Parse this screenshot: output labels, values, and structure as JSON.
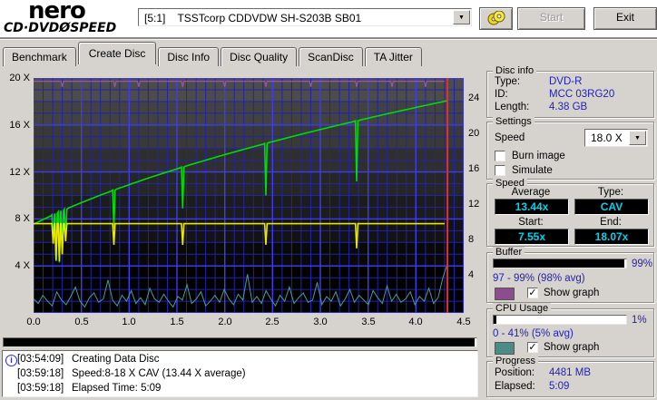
{
  "window": {
    "logo_line1": "nero",
    "logo_line2": "CD·DVDØSPEED",
    "drive_selector": "[5:1]    TSSTcorp CDDVDW SH-S203B SB01",
    "start_label": "Start",
    "exit_label": "Exit"
  },
  "tabs": {
    "items": [
      "Benchmark",
      "Create Disc",
      "Disc Info",
      "Disc Quality",
      "ScanDisc",
      "TA Jitter"
    ],
    "active": "Create Disc"
  },
  "chart_data": {
    "type": "line",
    "title": "Create Disc write test",
    "x_unit": "GB",
    "x_ticks": [
      "0.0",
      "0.5",
      "1.0",
      "1.5",
      "2.0",
      "2.5",
      "3.0",
      "3.5",
      "4.0",
      "4.5"
    ],
    "xlim": [
      0,
      4.5
    ],
    "left_axis": {
      "ticks": [
        "20 X",
        "16 X",
        "12 X",
        "8 X",
        "4 X"
      ],
      "max": 20
    },
    "right_axis": {
      "ticks": [
        "24",
        "20",
        "16",
        "12",
        "8",
        "4"
      ]
    },
    "grid": {
      "minor_color": "#2323a6",
      "major_color": "#3d3dee",
      "band_top": "#4c4c4c",
      "band_bottom": "#000000"
    },
    "series": [
      {
        "name": "write-speed",
        "color": "#00dd00",
        "kind": "ramp",
        "start": 7.55,
        "end": 18.07,
        "x_end": 4.33,
        "dips": [
          {
            "x": 0.205,
            "v": 6.0
          },
          {
            "x": 0.235,
            "v": 4.4
          },
          {
            "x": 0.27,
            "v": 4.3
          },
          {
            "x": 0.3,
            "v": 5.2
          },
          {
            "x": 0.335,
            "v": 6.3
          },
          {
            "x": 0.84,
            "v": 7.2
          },
          {
            "x": 1.56,
            "v": 8.9
          },
          {
            "x": 2.43,
            "v": 10.0
          },
          {
            "x": 3.38,
            "v": 11.2
          }
        ]
      },
      {
        "name": "rotation-speed",
        "color": "#e8e800",
        "kind": "flat",
        "baseline": 7.6,
        "x_end": 4.33,
        "dips": [
          {
            "x": 0.205,
            "v": 5.9
          },
          {
            "x": 0.235,
            "v": 4.5
          },
          {
            "x": 0.27,
            "v": 4.4
          },
          {
            "x": 0.3,
            "v": 5.0
          },
          {
            "x": 0.335,
            "v": 6.1
          },
          {
            "x": 0.84,
            "v": 5.8
          },
          {
            "x": 1.56,
            "v": 5.8
          },
          {
            "x": 2.43,
            "v": 5.8
          },
          {
            "x": 3.38,
            "v": 5.5
          }
        ]
      },
      {
        "name": "buffer-level",
        "color": "#9a55a8",
        "kind": "flat",
        "baseline": 19.72,
        "x_end": 4.33,
        "dips": [
          {
            "x": 0.3,
            "v": 19.25
          },
          {
            "x": 0.85,
            "v": 19.25
          },
          {
            "x": 1.1,
            "v": 19.25
          },
          {
            "x": 1.56,
            "v": 19.25
          },
          {
            "x": 2.0,
            "v": 19.25
          },
          {
            "x": 2.43,
            "v": 19.25
          },
          {
            "x": 2.9,
            "v": 19.25
          },
          {
            "x": 3.38,
            "v": 19.25
          },
          {
            "x": 3.75,
            "v": 19.25
          },
          {
            "x": 4.1,
            "v": 19.25
          }
        ]
      },
      {
        "name": "cpu-usage",
        "color": "#4a9a9a",
        "kind": "samples",
        "x_end": 4.33,
        "values": [
          1.2,
          0.8,
          1.5,
          1.0,
          0.6,
          1.8,
          1.1,
          0.7,
          1.4,
          2.2,
          1.0,
          0.5,
          1.3,
          1.7,
          0.9,
          1.2,
          2.8,
          1.1,
          0.6,
          1.5,
          1.0,
          1.9,
          0.8,
          1.3,
          0.7,
          2.1,
          1.2,
          0.9,
          1.6,
          1.0,
          0.5,
          1.4,
          1.1,
          2.4,
          0.8,
          1.2,
          1.8,
          0.6,
          1.0,
          1.5,
          0.9,
          2.0,
          1.2,
          0.7,
          1.6,
          1.1,
          3.3,
          0.9,
          1.4,
          0.8,
          1.9,
          1.2,
          0.6,
          1.5,
          1.0,
          2.2,
          0.8,
          1.3,
          1.7,
          0.9,
          1.1,
          2.6,
          0.7,
          1.4,
          1.0,
          1.8,
          0.6,
          1.2,
          2.0,
          0.9,
          1.5,
          1.1,
          0.7,
          1.9,
          1.3,
          0.8,
          2.3,
          1.0,
          1.6,
          0.9,
          1.2,
          1.8,
          0.7,
          1.4,
          1.0,
          2.1,
          0.8,
          1.3,
          3.0,
          4.2
        ]
      },
      {
        "name": "position-marker",
        "color": "#e03030",
        "kind": "vline",
        "x": 4.33
      }
    ]
  },
  "sidebar": {
    "disc_info": {
      "title": "Disc info",
      "rows": [
        {
          "label": "Type:",
          "value": "DVD-R"
        },
        {
          "label": "ID:",
          "value": "MCC 03RG20"
        },
        {
          "label": "Length:",
          "value": "4.38 GB"
        }
      ]
    },
    "settings": {
      "title": "Settings",
      "speed_label": "Speed",
      "speed_value": "18.0 X",
      "burn_image_label": "Burn image",
      "burn_image_checked": false,
      "simulate_label": "Simulate",
      "simulate_checked": false
    },
    "speed": {
      "title": "Speed",
      "average_label": "Average",
      "average": "13.44x",
      "type_label": "Type:",
      "type": "CAV",
      "start_label": "Start:",
      "start": "7.55x",
      "end_label": "End:",
      "end": "18.07x"
    },
    "buffer": {
      "title": "Buffer",
      "percent": "99%",
      "fill": 98.5,
      "range": "97 - 99% (98% avg)",
      "swatch": "#8c4d8c",
      "show_graph": "Show graph",
      "checked": true
    },
    "cpu": {
      "title": "CPU Usage",
      "percent": "1%",
      "fill": 2,
      "range": "0 - 41% (5% avg)",
      "swatch": "#4d8c85",
      "show_graph": "Show graph",
      "checked": true
    },
    "progress": {
      "title": "Progress",
      "rows": [
        {
          "label": "Position:",
          "value": "4481 MB"
        },
        {
          "label": "Elapsed:",
          "value": "5:09"
        }
      ]
    }
  },
  "burn_progress_percent": 99.6,
  "log": {
    "entries": [
      {
        "time": "[03:54:09]",
        "text": "Creating Data Disc",
        "icon": "info"
      },
      {
        "time": "[03:59:18]",
        "text": "Speed:8-18 X CAV (13.44 X average)",
        "icon": ""
      },
      {
        "time": "[03:59:18]",
        "text": "Elapsed Time:  5:09",
        "icon": ""
      }
    ]
  }
}
